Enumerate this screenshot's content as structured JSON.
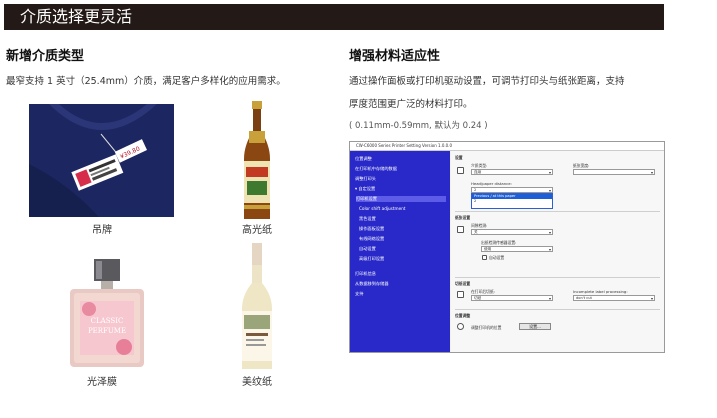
{
  "banner": {
    "title": "介质选择更灵活"
  },
  "left": {
    "heading": "新增介质类型",
    "desc": "最窄支持 1 英寸（25.4mm）介质，满足客户多样化的应用需求。",
    "items": [
      {
        "caption": "吊牌",
        "tag_text": "¥39.80"
      },
      {
        "caption": "高光纸"
      },
      {
        "caption": "光泽膜",
        "label_line1": "CLASSIC",
        "label_line2": "PERFUME"
      },
      {
        "caption": "美纹纸"
      }
    ]
  },
  "right": {
    "heading": "增强材料适应性",
    "desc_line1": "通过操作面板或打印机驱动设置，可调节打印头与纸张距离，支持",
    "desc_line2": "厚度范围更广泛的材料打印。",
    "note": "( 0.11mm-0.59mm, 默认为 0.24 )"
  },
  "window": {
    "title": "CW-C6000 Series Printer Setting Version 1.0.0.0",
    "sidebar": [
      {
        "label": "位置调整",
        "sub": false
      },
      {
        "label": "在打印机中存储的数据",
        "sub": false
      },
      {
        "label": "调整打印头",
        "sub": false
      },
      {
        "label": "▾ 自定设置",
        "sub": false
      },
      {
        "label": "打印机设置",
        "sub": true,
        "selected": true
      },
      {
        "label": "Color shift adjustment",
        "sub": true
      },
      {
        "label": "黑色设置",
        "sub": true
      },
      {
        "label": "操作面板设置",
        "sub": true
      },
      {
        "label": "有线网络设置",
        "sub": true
      },
      {
        "label": "自动设置",
        "sub": true
      },
      {
        "label": "高级打印设置",
        "sub": true
      },
      {
        "label": "打印机信息",
        "sub": false
      },
      {
        "label": "从数据移到存储器",
        "sub": false
      },
      {
        "label": "支持",
        "sub": false
      }
    ],
    "main": {
      "section1": "设置",
      "media_type_label": "介质类型:",
      "media_type_value": "连续",
      "width_label": "纸张宽度:",
      "head_label": "Head/paper distance:",
      "head_value": "2",
      "dropdown_options": [
        "Previous / at this paper",
        "2"
      ],
      "section2": "纸张设置",
      "gap_label": "间隙检测:",
      "gap_value": "关",
      "sensor_label": "出纸检测传感器设置:",
      "sensor_value": "使用",
      "auto_label": "自动设置",
      "section3": "切纸设置",
      "cut_label": "在打印后切纸:",
      "cut_value": "切纸",
      "cut_process_label": "Incomplete label processing:",
      "cut_process_value": "don't cut",
      "section4": "位置调整",
      "pos_label": "调整打印机的位置",
      "pos_button": "设置..."
    }
  }
}
